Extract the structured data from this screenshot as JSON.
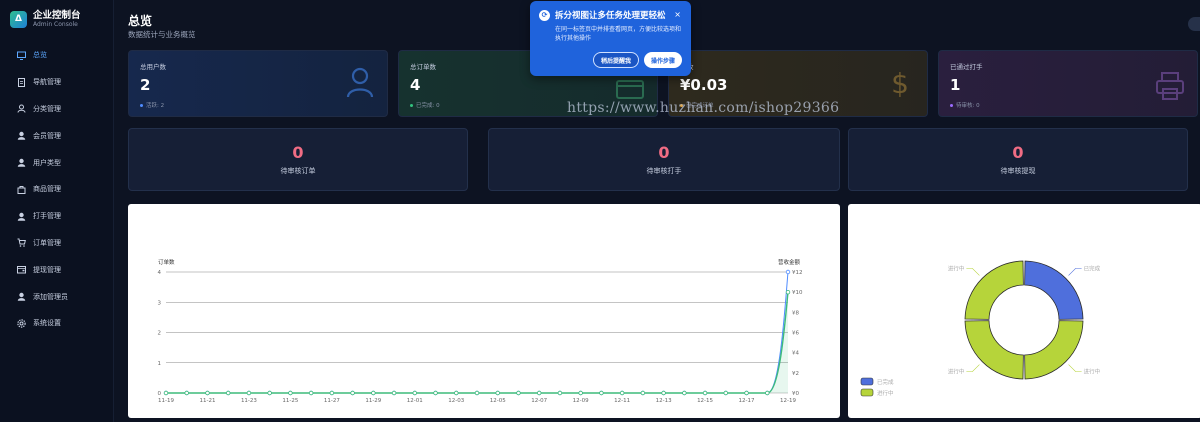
{
  "brand": {
    "title": "企业控制台",
    "subtitle": "Admin Console",
    "logo": "Δ"
  },
  "sidebar": {
    "items": [
      {
        "label": "总览",
        "icon": "monitor-icon",
        "active": true
      },
      {
        "label": "导航管理",
        "icon": "document-icon"
      },
      {
        "label": "分类管理",
        "icon": "user-outline-icon"
      },
      {
        "label": "会员管理",
        "icon": "user-icon"
      },
      {
        "label": "用户类型",
        "icon": "user-icon"
      },
      {
        "label": "商品管理",
        "icon": "bag-icon"
      },
      {
        "label": "打手管理",
        "icon": "user-icon"
      },
      {
        "label": "订单管理",
        "icon": "cart-icon"
      },
      {
        "label": "提现管理",
        "icon": "wallet-icon"
      },
      {
        "label": "添加管理员",
        "icon": "user-icon"
      },
      {
        "label": "系统设置",
        "icon": "gear-icon"
      }
    ]
  },
  "header": {
    "title": "总览",
    "subtitle": "数据统计与业务概览"
  },
  "stats": [
    {
      "label": "总用户数",
      "value": "2",
      "sub": "活跃: 2",
      "dot_color": "#4f8cff",
      "icon": "user-icon"
    },
    {
      "label": "总订单数",
      "value": "4",
      "sub": "已完成: 0",
      "dot_color": "#33c27f",
      "icon": "card-icon"
    },
    {
      "label": "收",
      "value": "¥0.03",
      "sub": "已完成订单",
      "dot_color": "#e2a33b",
      "icon": "dollar-icon"
    },
    {
      "label": "已通过打手",
      "value": "1",
      "sub": "待审核: 0",
      "dot_color": "#9b6bff",
      "icon": "printer-icon"
    }
  ],
  "pending": [
    {
      "value": "0",
      "label": "待审核订单"
    },
    {
      "value": "0",
      "label": "待审核打手"
    },
    {
      "value": "0",
      "label": "待审核提现"
    }
  ],
  "popup": {
    "title": "拆分视图让多任务处理更轻松",
    "body": "在同一标签页中并排查看网页，方便比较选项和执行其他操作",
    "btn_later": "稍后提醒我",
    "btn_steps": "操作步骤",
    "close": "×"
  },
  "watermark": "https://www.huzhan.com/ishop29366",
  "chart_data": [
    {
      "type": "line",
      "ylabel": "订单数",
      "y2label": "营收金额",
      "x": [
        "11-19",
        "11-20",
        "11-21",
        "11-22",
        "11-23",
        "11-24",
        "11-25",
        "11-26",
        "11-27",
        "11-28",
        "11-29",
        "11-30",
        "12-01",
        "12-02",
        "12-03",
        "12-04",
        "12-05",
        "12-06",
        "12-07",
        "12-08",
        "12-09",
        "12-10",
        "12-11",
        "12-12",
        "12-13",
        "12-14",
        "12-15",
        "12-16",
        "12-17",
        "12-18",
        "12-19"
      ],
      "xticks": [
        "11-19",
        "11-21",
        "11-23",
        "11-25",
        "11-27",
        "11-29",
        "12-01",
        "12-03",
        "12-05",
        "12-07",
        "12-09",
        "12-11",
        "12-13",
        "12-15",
        "12-17",
        "12-19"
      ],
      "ylim": [
        0,
        4
      ],
      "yticks": [
        "0",
        "1",
        "2",
        "3",
        "4"
      ],
      "y2lim": [
        0,
        12
      ],
      "y2ticks": [
        "¥0",
        "¥2",
        "¥4",
        "¥6",
        "¥8",
        "¥10",
        "¥12"
      ],
      "series": [
        {
          "color": "#4f8cff",
          "values": [
            0,
            0,
            0,
            0,
            0,
            0,
            0,
            0,
            0,
            0,
            0,
            0,
            0,
            0,
            0,
            0,
            0,
            0,
            0,
            0,
            0,
            0,
            0,
            0,
            0,
            0,
            0,
            0,
            0,
            0,
            4
          ]
        },
        {
          "color": "#3dbb7a",
          "axis": "right",
          "values": [
            0,
            0,
            0,
            0,
            0,
            0,
            0,
            0,
            0,
            0,
            0,
            0,
            0,
            0,
            0,
            0,
            0,
            0,
            0,
            0,
            0,
            0,
            0,
            0,
            0,
            0,
            0,
            0,
            0,
            0,
            10
          ]
        }
      ],
      "grid": true
    },
    {
      "type": "pie",
      "donut": true,
      "categories": [
        "已完成",
        "进行中"
      ],
      "values": [
        1,
        3
      ],
      "colors": [
        "#4f6fdc",
        "#b6d43a"
      ],
      "slice_labels": [
        "已完成",
        "进行中",
        "进行中",
        "进行中"
      ],
      "legend": "bottom-left"
    }
  ]
}
